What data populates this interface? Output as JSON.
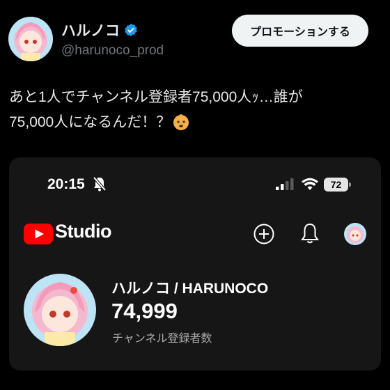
{
  "post": {
    "author_name": "ハルノコ",
    "handle": "@harunoco_prod",
    "promote_button": "プロモーションする",
    "text_line1": "あと1人でチャンネル登録者75,000人ｯ…誰が",
    "text_line2": "75,000人になるんだ！？",
    "emoji": "baby-face-emoji"
  },
  "screenshot": {
    "status_bar": {
      "time": "20:15",
      "battery": "72"
    },
    "app_header": {
      "title": "Studio"
    },
    "channel": {
      "name": "ハルノコ / HARUNOCO",
      "subscriber_count": "74,999",
      "subscriber_label": "チャンネル登録者数"
    }
  },
  "colors": {
    "background": "#000000",
    "verified": "#1d9bf0",
    "youtube_red": "#ff0000",
    "card": "#161616"
  }
}
